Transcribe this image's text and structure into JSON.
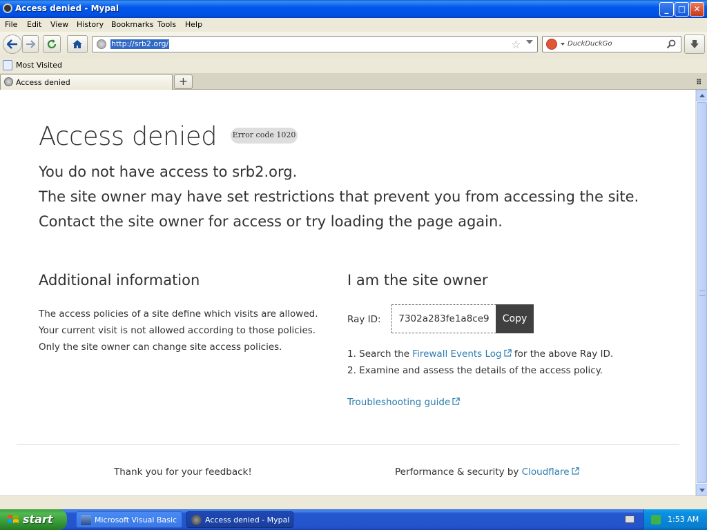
{
  "window": {
    "title": "Access denied - Mypal",
    "minimize_label": "_",
    "maximize_label": "□",
    "close_label": "✕"
  },
  "menu": [
    "File",
    "Edit",
    "View",
    "History",
    "Bookmarks",
    "Tools",
    "Help"
  ],
  "navbar": {
    "url": "http://srb2.org/",
    "search_placeholder": "DuckDuckGo"
  },
  "bookmarks": {
    "most_visited": "Most Visited"
  },
  "tabs": {
    "active": "Access denied",
    "new_tab_label": "+"
  },
  "page": {
    "title": "Access denied",
    "error_code": "Error code 1020",
    "lead": [
      "You do not have access to srb2.org.",
      "The site owner may have set restrictions that prevent you from accessing the site.",
      "Contact the site owner for access or try loading the page again."
    ],
    "additional": {
      "heading": "Additional information",
      "lines": [
        "The access policies of a site define which visits are allowed.",
        "Your current visit is not allowed according to those policies.",
        "Only the site owner can change site access policies."
      ]
    },
    "owner": {
      "heading": "I am the site owner",
      "ray_label": "Ray ID:",
      "ray_id": "7302a283fe1a8ce9",
      "copy_label": "Copy",
      "step1_prefix": "1.  Search the ",
      "step1_link": "Firewall Events Log",
      "step1_suffix": " for the above Ray ID.",
      "step2": "2. Examine and assess the details of the access policy.",
      "troubleshooting": "Troubleshooting guide"
    },
    "footer": {
      "feedback": "Thank you for your feedback!",
      "perf_prefix": "Performance & security by ",
      "perf_link": "Cloudflare"
    }
  },
  "taskbar": {
    "start_label": "start",
    "tasks": [
      "Microsoft Visual Basic",
      "Access denied - Mypal"
    ],
    "clock": "1:53 AM"
  },
  "colors": {
    "link": "#2c7cb0",
    "copy_button": "#404040",
    "badge": "#dedede",
    "titlebar": "#0058ee"
  }
}
